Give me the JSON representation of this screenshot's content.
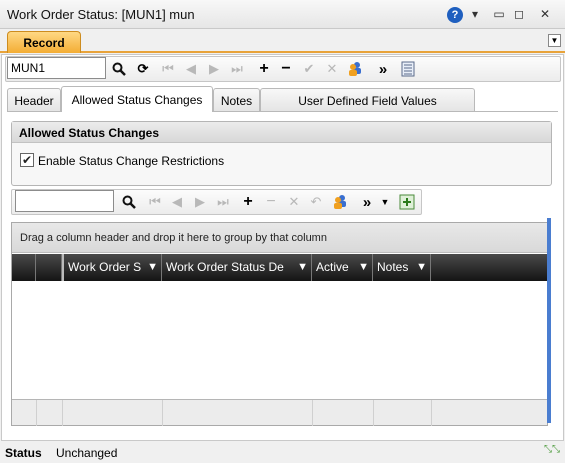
{
  "window": {
    "title": "Work Order Status: [MUN1] mun"
  },
  "title_controls": {
    "help": "?",
    "dropdown": "▾",
    "minimize": "▭",
    "restore": "◻",
    "close": "✕"
  },
  "record_tab": {
    "label": "Record"
  },
  "record_toolbar": {
    "search_value": "MUN1"
  },
  "tabs": [
    {
      "label": "Header"
    },
    {
      "label": "Allowed Status Changes"
    },
    {
      "label": "Notes"
    },
    {
      "label": "User Defined Field Values"
    }
  ],
  "group": {
    "title": "Allowed Status Changes",
    "checkbox_label": "Enable Status Change Restrictions",
    "checkbox_checked": true
  },
  "grid_toolbar": {
    "search_value": ""
  },
  "grid": {
    "group_hint": "Drag a column header and drop it here to group by that column",
    "columns": [
      "Work Order S",
      "Work Order Status De",
      "Active",
      "Notes"
    ]
  },
  "status": {
    "label": "Status",
    "value": "Unchanged"
  },
  "colors": {
    "accent_tab": "#f3ad34",
    "header_dark": "#141414",
    "help_blue": "#1f5fbf"
  }
}
